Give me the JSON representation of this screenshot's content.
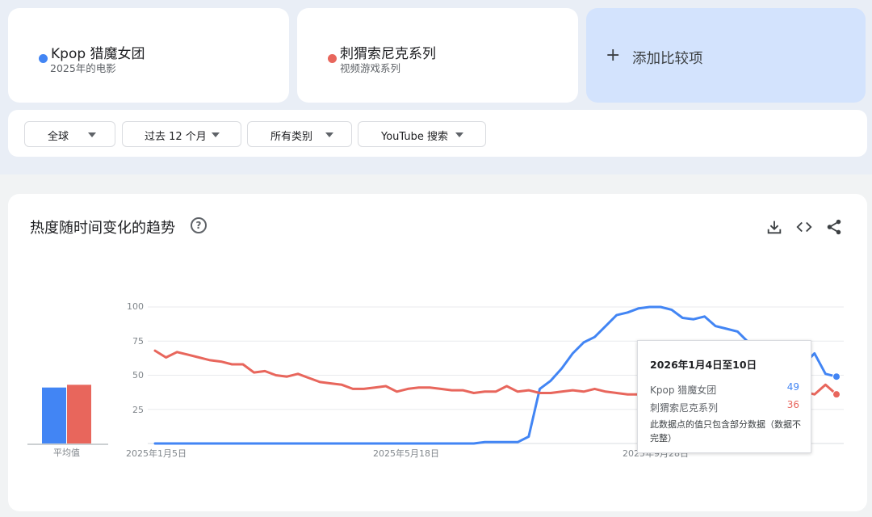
{
  "terms": [
    {
      "name": "Kpop 猎魔女团",
      "subtitle": "2025年的电影",
      "color": "#4285f4"
    },
    {
      "name": "刺猬索尼克系列",
      "subtitle": "视频游戏系列",
      "color": "#e8665c"
    }
  ],
  "add_compare": {
    "label": "添加比较项",
    "icon": "plus-icon"
  },
  "filters": [
    {
      "label": "全球"
    },
    {
      "label": "过去 12 个月"
    },
    {
      "label": "所有类别"
    },
    {
      "label": "YouTube 搜索"
    }
  ],
  "chart_section": {
    "title": "热度随时间变化的趋势",
    "help_glyph": "?",
    "icons": [
      "download-icon",
      "embed-icon",
      "share-icon"
    ],
    "average_label": "平均值"
  },
  "chart_data": {
    "type": "line",
    "yticks": [
      100,
      75,
      50,
      25
    ],
    "ylim": [
      0,
      100
    ],
    "x_tick_labels": [
      "2025年1月5日",
      "2025年5月18日",
      "2025年9月28日"
    ],
    "grid": true,
    "series": [
      {
        "name": "Kpop 猎魔女团",
        "color": "#4285f4",
        "values": [
          0,
          0,
          0,
          0,
          0,
          0,
          0,
          0,
          0,
          0,
          0,
          0,
          0,
          0,
          0,
          0,
          0,
          0,
          0,
          0,
          0,
          0,
          0,
          0,
          0,
          0,
          0,
          0,
          0,
          0,
          1,
          1,
          1,
          1,
          5,
          40,
          46,
          55,
          66,
          74,
          78,
          86,
          94,
          96,
          99,
          100,
          100,
          98,
          92,
          91,
          93,
          86,
          84,
          82,
          74,
          72,
          68,
          68,
          57,
          58,
          66,
          51,
          49
        ],
        "average": 41
      },
      {
        "name": "刺猬索尼克系列",
        "color": "#e8665c",
        "values": [
          68,
          63,
          67,
          65,
          63,
          61,
          60,
          58,
          58,
          52,
          53,
          50,
          49,
          51,
          48,
          45,
          44,
          43,
          40,
          40,
          41,
          42,
          38,
          40,
          41,
          41,
          40,
          39,
          39,
          37,
          38,
          38,
          42,
          38,
          39,
          37,
          37,
          38,
          39,
          38,
          40,
          38,
          37,
          36,
          36,
          39,
          40,
          41,
          40,
          38,
          35,
          38,
          39,
          37,
          36,
          37,
          38,
          37,
          36,
          38,
          36,
          43,
          36
        ],
        "average": 43
      }
    ],
    "tooltip": {
      "title": "2026年1月4日至10日",
      "values": [
        49,
        36
      ],
      "note": "此数据点的值只包含部分数据（数据不完整）"
    }
  }
}
